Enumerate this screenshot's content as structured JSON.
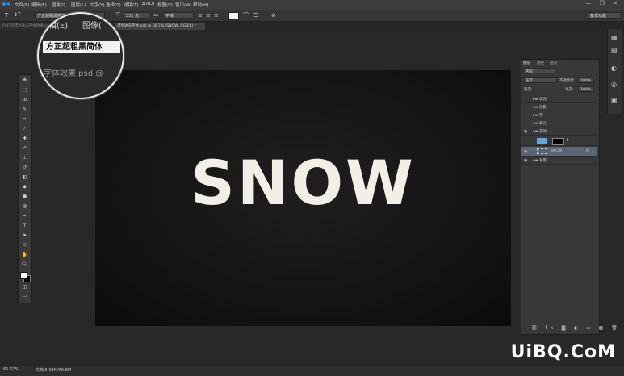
{
  "app": {
    "logo": "Ps"
  },
  "menu": [
    "文件(F)",
    "编辑(E)",
    "图像(I)",
    "图层(L)",
    "文字(Y)",
    "选择(S)",
    "滤镜(T)",
    "3D(D)",
    "视图(V)",
    "窗口(W)",
    "帮助(H)"
  ],
  "options": {
    "font_family": "方正超粗黑简体",
    "font_style": "-",
    "font_size": "331 点",
    "aa_label": "aa",
    "aa_mode": "平滑",
    "workspace": "基本功能"
  },
  "tabs": [
    {
      "label": "PS打造漂亮冰冻字体效果.psd @ 66.7% (SNOW, RGB/8) *"
    },
    {
      "label": "漂亮冰冻字体.psd @ 66.7% (SNOW, RGB/8) *"
    }
  ],
  "zoom": {
    "menu1": "辑(E)",
    "menu2": "图像(",
    "font": "方正超粗黑简体",
    "filename": "字体效果.psd @"
  },
  "canvas": {
    "text": "SNOW"
  },
  "panel": {
    "tabs": [
      "图层",
      "路径",
      "通道"
    ],
    "kind": "类型",
    "blend": "正常",
    "opacity_label": "不透明度:",
    "opacity": "100%",
    "lock_label": "锁定:",
    "fill_label": "填充:",
    "fill": "100%",
    "layers": [
      {
        "name": "高光",
        "type": "folder"
      },
      {
        "name": "投影",
        "type": "folder"
      },
      {
        "name": "雪",
        "type": "folder"
      },
      {
        "name": "高光",
        "type": "folder"
      },
      {
        "name": "字效",
        "type": "folder"
      },
      {
        "name": "1",
        "type": "layer"
      },
      {
        "name": "SNOW",
        "type": "text"
      },
      {
        "name": "背景",
        "type": "folder"
      }
    ]
  },
  "status": {
    "zoom": "66.67%",
    "doc": "文档:5.93M/66.8M"
  },
  "watermark": "UiBQ.CoM",
  "colors": {
    "accent": "#31a8ff",
    "selected": "#566677",
    "snow": "#f1efe6"
  }
}
